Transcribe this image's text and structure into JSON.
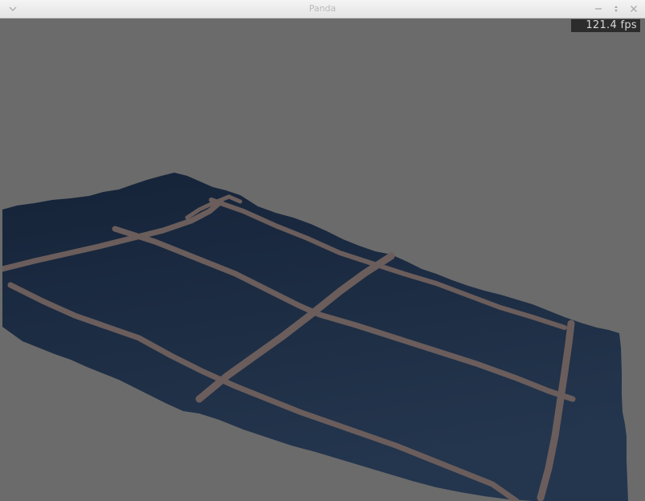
{
  "window": {
    "title": "Panda",
    "controls": {
      "menu_icon": "chevron-down-icon",
      "minimize_icon": "minimize-icon",
      "maximize_icon": "maximize-icon",
      "close_icon": "close-icon"
    }
  },
  "viewport": {
    "fps_label": "121.4 fps",
    "background_color": "#6b6b6b",
    "terrain_color": "#1f3049",
    "road_color": "#6b5f5d"
  }
}
